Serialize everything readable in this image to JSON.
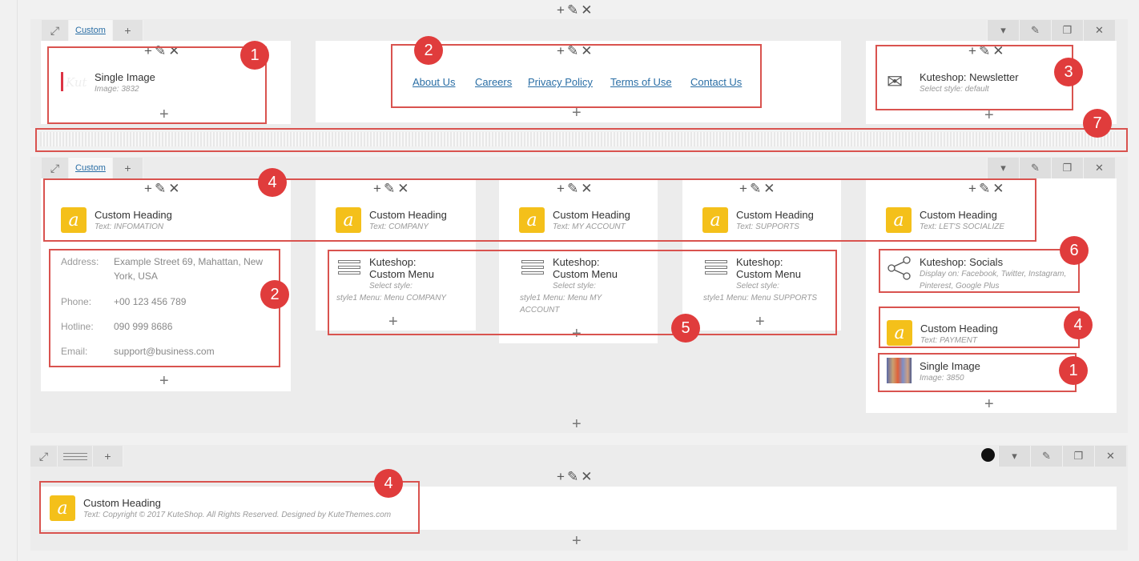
{
  "row1": {
    "tab_label": "Custom",
    "col1": {
      "title": "Single Image",
      "sub": "Image: 3832",
      "badge": "1"
    },
    "col2": {
      "links": [
        "About Us",
        "Careers",
        "Privacy Policy",
        "Terms of Use",
        "Contact Us"
      ],
      "badge": "2"
    },
    "col3": {
      "title": "Kuteshop: Newsletter",
      "sub": "Select style: default",
      "badge": "3"
    }
  },
  "separator": {
    "badge": "7"
  },
  "row2": {
    "tab_label": "Custom",
    "headings": [
      {
        "title": "Custom Heading",
        "sub": "Text: INFOMATION"
      },
      {
        "title": "Custom Heading",
        "sub": "Text: COMPANY"
      },
      {
        "title": "Custom Heading",
        "sub": "Text: MY ACCOUNT"
      },
      {
        "title": "Custom Heading",
        "sub": "Text: SUPPORTS"
      },
      {
        "title": "Custom Heading",
        "sub": "Text: LET'S SOCIALIZE"
      }
    ],
    "headings_badge": "4",
    "address": {
      "badge": "2",
      "rows": [
        {
          "label": "Address:",
          "value": "Example Street 69, Mahattan, New York, USA"
        },
        {
          "label": "Phone:",
          "value": "+00 123 456 789"
        },
        {
          "label": "Hotline:",
          "value": "090 999 8686"
        },
        {
          "label": "Email:",
          "value": "support@business.com"
        }
      ]
    },
    "menus": [
      {
        "title1": "Kuteshop:",
        "title2": "Custom Menu",
        "sub1": "Select style:",
        "sub2": "style1  Menu: Menu COMPANY"
      },
      {
        "title1": "Kuteshop:",
        "title2": "Custom Menu",
        "sub1": "Select style:",
        "sub2": "style1  Menu: Menu MY",
        "sub3": "ACCOUNT"
      },
      {
        "title1": "Kuteshop:",
        "title2": "Custom Menu",
        "sub1": "Select style:",
        "sub2": "style1  Menu: Menu SUPPORTS"
      }
    ],
    "menus_badge": "5",
    "socials": {
      "title": "Kuteshop: Socials",
      "sub1": "Display on: Facebook, Twitter, Instagram,",
      "sub2": "Pinterest, Google Plus",
      "badge": "6"
    },
    "payment": {
      "title": "Custom Heading",
      "sub": "Text: PAYMENT",
      "badge": "4"
    },
    "image2": {
      "title": "Single Image",
      "sub": "Image: 3850",
      "badge": "1"
    }
  },
  "row3": {
    "heading": {
      "title": "Custom Heading",
      "sub": "Text: Copyright © 2017 KuteShop. All Rights Reserved. Designed by KuteThemes.com",
      "badge": "4"
    }
  },
  "colors": {
    "badge": "#e03c3c",
    "highlight": "#d9534f",
    "heading_icon": "#f4c01a",
    "link": "#2a6ea5"
  }
}
